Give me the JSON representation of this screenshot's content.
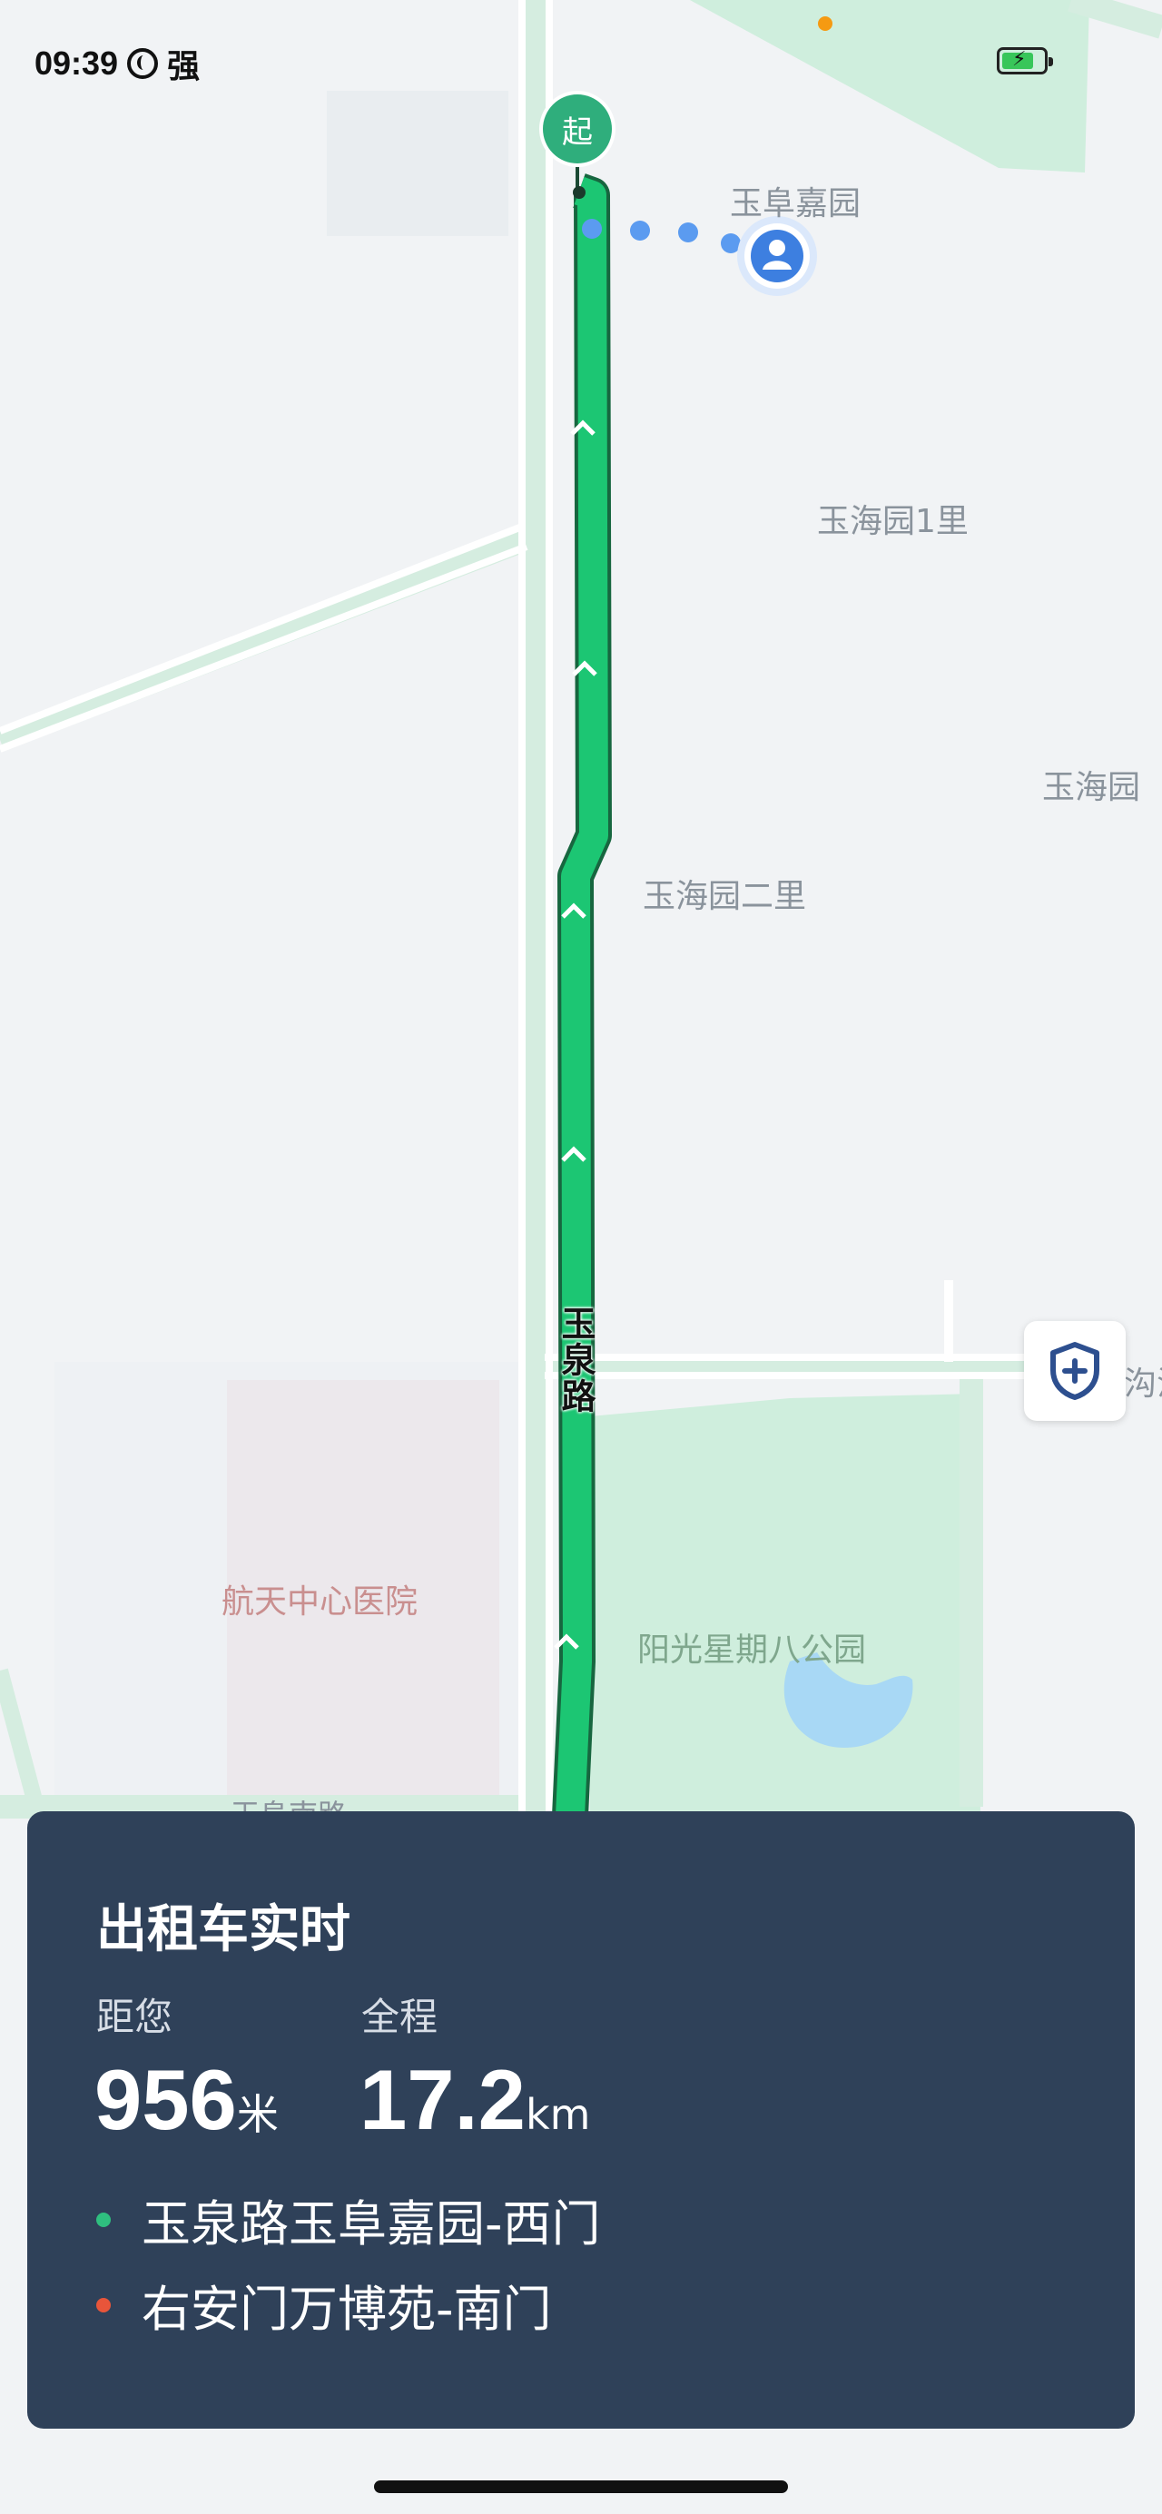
{
  "status_bar": {
    "time": "09:39",
    "carrier": "强"
  },
  "map": {
    "start_marker": "起",
    "road_name": "玉泉路",
    "labels": {
      "yufu_jiayuan": "玉阜嘉园",
      "yuhaiyuan_1li": "玉海园1里",
      "yuhaiyuan_partial": "玉海园",
      "yuhaiyuan_erli": "玉海园二里",
      "hospital": "航天中心医院",
      "park": "阳光星期八公园",
      "bottom_road": "玉阜南路",
      "right_edge_partial": "沟泊"
    },
    "colors": {
      "route": "#1cc673",
      "route_border": "#17663f",
      "water": "#a8d8f5",
      "park": "#cfeedd"
    },
    "icons": {
      "safety": "shield-plus-icon",
      "user": "user-avatar-icon"
    }
  },
  "trip_card": {
    "title": "出租车实时",
    "distance_label": "距您",
    "distance_value": "956",
    "distance_unit": "米",
    "total_label": "全程",
    "total_value": "17.2",
    "total_unit": "km",
    "origin": "玉泉路玉阜嘉园-西门",
    "destination": "右安门万博苑-南门",
    "origin_color": "#2fbf7f",
    "destination_color": "#e8553a"
  }
}
